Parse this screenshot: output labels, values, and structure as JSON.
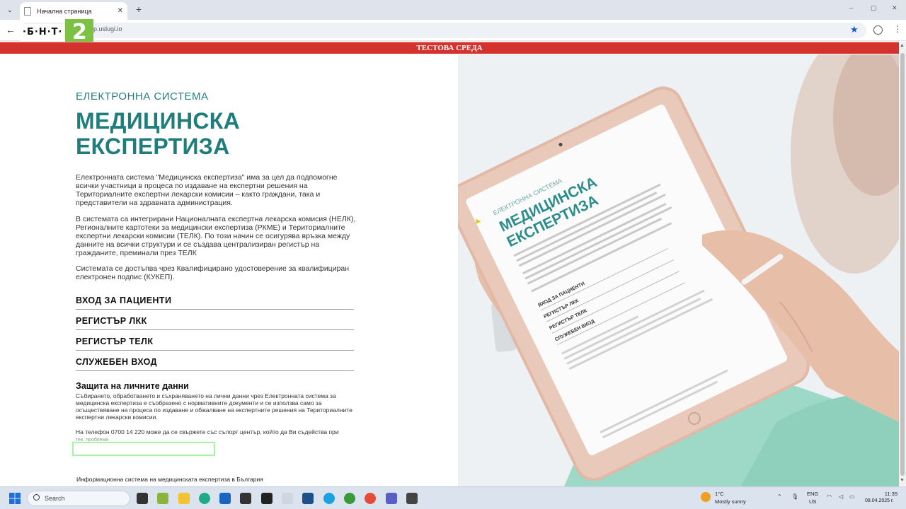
{
  "browser": {
    "tab_title": "Начална страница",
    "new_tab_icon": "plus-icon",
    "url": "p.uslugi.io",
    "window_controls": [
      "–",
      "▢",
      "✕"
    ]
  },
  "logo": {
    "text": "·Б·Н·Т·",
    "number": "2"
  },
  "banner": {
    "text": "ТЕСТОВА СРЕДА",
    "color": "#d4322c"
  },
  "page": {
    "kicker": "ЕЛЕКТРОННА СИСТЕМА",
    "headline_line1": "МЕДИЦИНСКА",
    "headline_line2": "ЕКСПЕРТИЗА",
    "accent_color": "#1f7e7b",
    "para1": "Електронната система \"Медицинска експертиза\" има за цел да подпомогне всички участници в процеса по издаване на експертни решения на Териториалните експертни лекарски комисии – както граждани, така и представители на здравната администрация.",
    "para2": "В системата са интегрирани Националната експертна лекарска комисия (НЕЛК), Регионалните картотеки за медицински експертиза (РКМЕ) и Териториалните експертни лекарски комисии (ТЕЛК). По този начин се осигурява връзка между данните на всички структури и се създава централизиран регистър на гражданите, преминали през ТЕЛК",
    "para3": "Системата се достъпва чрез Квалифицирано удостоверение за квалифициран електронен подпис (КУКЕП).",
    "nav": [
      "ВХОД ЗА ПАЦИЕНТИ",
      "РЕГИСТЪР ЛКК",
      "РЕГИСТЪР ТЕЛК",
      "СЛУЖЕБЕН ВХОД"
    ],
    "privacy_title": "Защита на личните данни",
    "privacy_text": "Събирането, обработването и съхраняването на лични данни чрез Електронната система за медицинска експертиза е съобразено с нормативните документи и се използва само за осъществяване на процеса по издаване и обжалване на експертните решения на Териториалните експертни лекарски комисии.",
    "phone_text": "На телефон 0700 14 220 може да се свържете със сълорт център, който да Ви съдейства при",
    "phone_text_cut": "тех. проблеми",
    "footer": "Информационна система на медицинската експертиза в България"
  },
  "hero_tablet": {
    "kicker": "ЕЛЕКТРОННА СИСТЕМА",
    "line1": "МЕДИЦИНСКА",
    "line2": "ЕКСПЕРТИЗА",
    "links": [
      "ВХОД ЗА ПАЦИЕНТИ",
      "РЕГИСТЪР ЛКК",
      "РЕГИСТЪР ТЕЛК",
      "СЛУЖЕБЕН ВХОД"
    ]
  },
  "taskbar": {
    "search_placeholder": "Search",
    "temperature": "1°C",
    "weather": "Mostly sunny",
    "lang_line1": "ENG",
    "lang_line2": "US",
    "time": "11:35",
    "date": "08.04.2025 г."
  }
}
